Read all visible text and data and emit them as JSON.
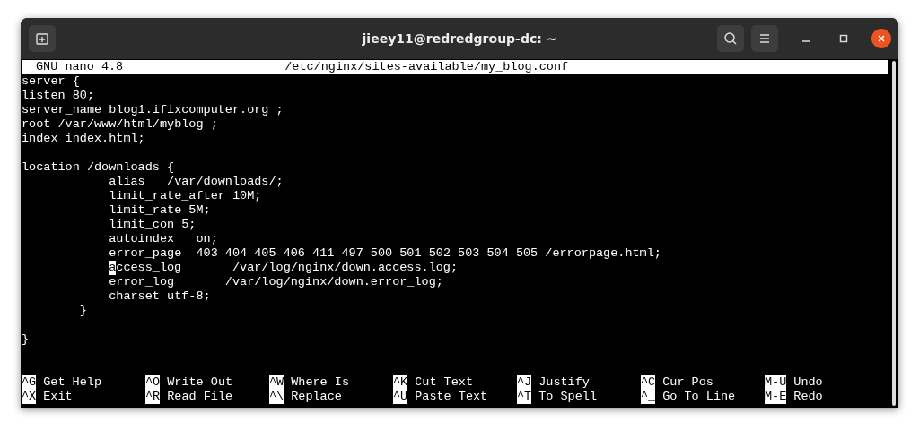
{
  "window": {
    "title": "jieey11@redredgroup-dc: ~"
  },
  "nano": {
    "version": "GNU nano 4.8",
    "file": "/etc/nginx/sites-available/my_blog.conf"
  },
  "lines": [
    {
      "kind": "text",
      "text": "server {"
    },
    {
      "kind": "text",
      "text": "listen 80;"
    },
    {
      "kind": "text",
      "text": "server_name blog1.ifixcomputer.org ;"
    },
    {
      "kind": "text",
      "text": "root /var/www/html/myblog ;"
    },
    {
      "kind": "text",
      "text": "index index.html;"
    },
    {
      "kind": "blank"
    },
    {
      "kind": "text",
      "text": "location /downloads {"
    },
    {
      "kind": "text",
      "text": "            alias   /var/downloads/;"
    },
    {
      "kind": "text",
      "text": "            limit_rate_after 10M;"
    },
    {
      "kind": "text",
      "text": "            limit_rate 5M;"
    },
    {
      "kind": "text",
      "text": "            limit_con 5;"
    },
    {
      "kind": "text",
      "text": "            autoindex   on;"
    },
    {
      "kind": "text",
      "text": "            error_page  403 404 405 406 411 497 500 501 502 503 504 505 /errorpage.html;"
    },
    {
      "kind": "cursor",
      "cursor": "a",
      "after": "ccess_log       /var/log/nginx/down.access.log;"
    },
    {
      "kind": "text",
      "text": "            error_log       /var/log/nginx/down.error_log;"
    },
    {
      "kind": "text",
      "text": "            charset utf-8;"
    },
    {
      "kind": "text",
      "text": "        }"
    },
    {
      "kind": "blank"
    },
    {
      "kind": "text",
      "text": "}"
    }
  ],
  "shortcuts": [
    {
      "key": "^G",
      "label": "Get Help"
    },
    {
      "key": "^O",
      "label": "Write Out"
    },
    {
      "key": "^W",
      "label": "Where Is"
    },
    {
      "key": "^K",
      "label": "Cut Text"
    },
    {
      "key": "^J",
      "label": "Justify"
    },
    {
      "key": "^C",
      "label": "Cur Pos"
    },
    {
      "key": "M-U",
      "label": "Undo"
    },
    {
      "key": "^X",
      "label": "Exit"
    },
    {
      "key": "^R",
      "label": "Read File"
    },
    {
      "key": "^\\",
      "label": "Replace"
    },
    {
      "key": "^U",
      "label": "Paste Text"
    },
    {
      "key": "^T",
      "label": "To Spell"
    },
    {
      "key": "^_",
      "label": "Go To Line"
    },
    {
      "key": "M-E",
      "label": "Redo"
    }
  ]
}
